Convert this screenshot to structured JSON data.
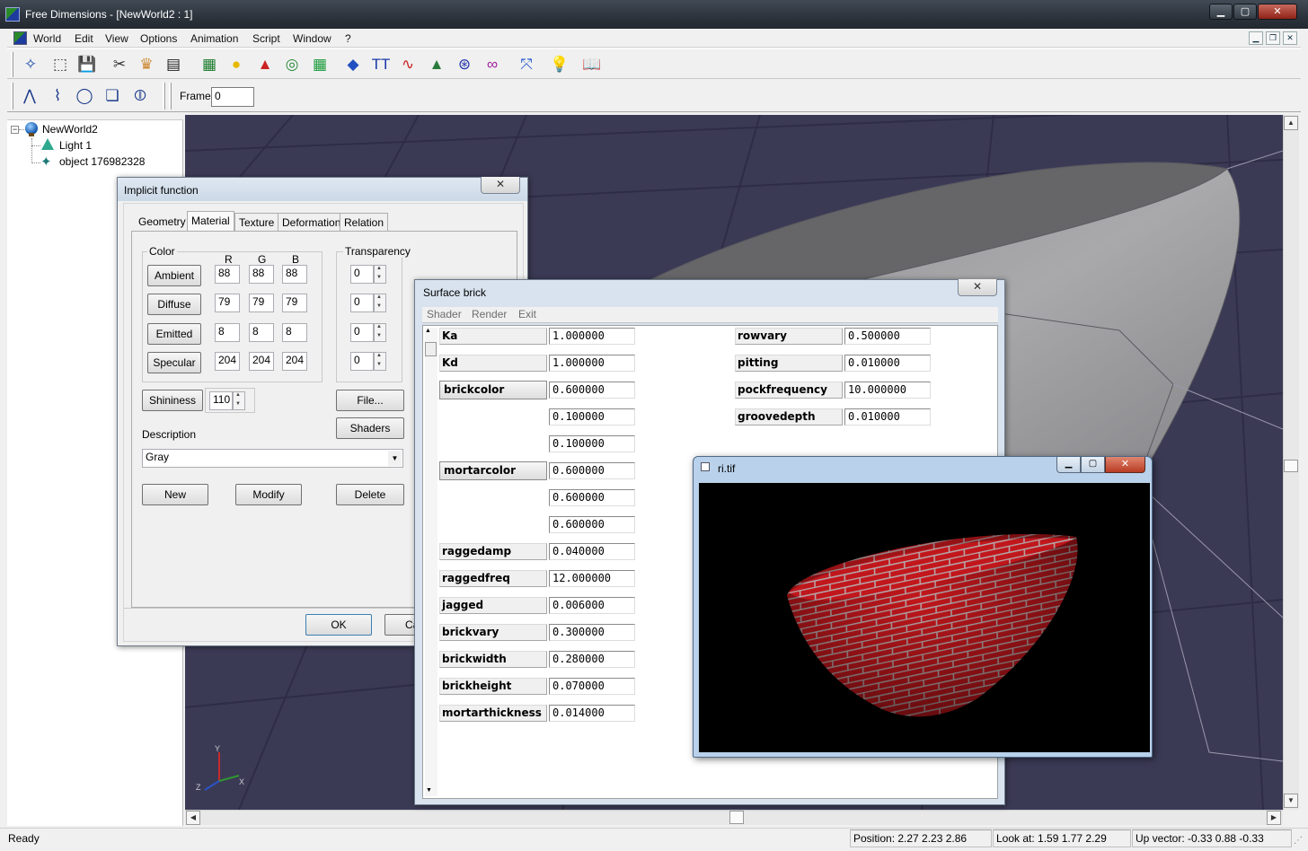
{
  "window": {
    "title": "Free Dimensions - [NewWorld2 : 1]"
  },
  "menu": [
    "World",
    "Edit",
    "View",
    "Options",
    "Animation",
    "Script",
    "Window",
    "?"
  ],
  "toolbar": {
    "icons": [
      "wand-icon",
      "box-icon",
      "save-icon",
      "cut-icon",
      "crown-icon",
      "clipboard-icon",
      "rubik-cube-icon",
      "sphere-icon",
      "cone-icon",
      "torus-icon",
      "grid-icon",
      "plane-icon",
      "text-icon",
      "curve-icon",
      "terrain-icon",
      "surface-icon",
      "infinity-icon",
      "axes-icon",
      "light-bulb-icon",
      "book-icon"
    ],
    "icon_glyphs": [
      "✧",
      "⬚",
      "💾",
      "✂",
      "♛",
      "▤",
      "▦",
      "●",
      "▲",
      "◎",
      "▦",
      "◆",
      "TT",
      "∿",
      "▲",
      "⊛",
      "∞",
      "⤧",
      "💡",
      "📖"
    ],
    "frame_label": "Frame:",
    "frame_value": "0",
    "edit_icons": [
      "polyline-icon",
      "spline-icon",
      "bezier-icon",
      "extrude-icon",
      "lathe-icon"
    ],
    "edit_glyphs": [
      "⋀",
      "⌇",
      "◯",
      "❏",
      "⦷"
    ]
  },
  "tree": {
    "root": "NewWorld2",
    "children": [
      "Light 1",
      "object 176982328"
    ]
  },
  "implicit_dialog": {
    "title": "Implicit function",
    "close": "✕",
    "tabs": [
      "Geometry",
      "Material",
      "Texture",
      "Deformation",
      "Relation"
    ],
    "color_group": "Color",
    "headers": [
      "R",
      "G",
      "B"
    ],
    "rows": [
      {
        "label": "Ambient",
        "r": "88",
        "g": "88",
        "b": "88",
        "t": "0"
      },
      {
        "label": "Diffuse",
        "r": "79",
        "g": "79",
        "b": "79",
        "t": "0"
      },
      {
        "label": "Emitted",
        "r": "8",
        "g": "8",
        "b": "8",
        "t": "0"
      },
      {
        "label": "Specular",
        "r": "204",
        "g": "204",
        "b": "204",
        "t": "0"
      }
    ],
    "transparency_group": "Transparency",
    "shininess_label": "Shininess",
    "shininess_value": "110",
    "file_button": "File...",
    "shaders_button": "Shaders",
    "description_label": "Description",
    "description_value": "Gray",
    "new_button": "New",
    "modify_button": "Modify",
    "delete_button": "Delete",
    "ok_button": "OK",
    "cancel_button": "Canc"
  },
  "surface_dialog": {
    "title": "Surface brick",
    "close": "✕",
    "menu": [
      "Shader",
      "Render",
      "Exit"
    ],
    "left_params": [
      {
        "label": "Ka",
        "values": [
          "1.000000"
        ]
      },
      {
        "label": "Kd",
        "values": [
          "1.000000"
        ]
      },
      {
        "label": "brickcolor",
        "button": true,
        "values": [
          "0.600000",
          "0.100000",
          "0.100000"
        ]
      },
      {
        "label": "mortarcolor",
        "button": true,
        "values": [
          "0.600000",
          "0.600000",
          "0.600000"
        ]
      },
      {
        "label": "raggedamp",
        "values": [
          "0.040000"
        ]
      },
      {
        "label": "raggedfreq",
        "values": [
          "12.000000"
        ]
      },
      {
        "label": "jagged",
        "values": [
          "0.006000"
        ]
      },
      {
        "label": "brickvary",
        "values": [
          "0.300000"
        ]
      },
      {
        "label": "brickwidth",
        "values": [
          "0.280000"
        ]
      },
      {
        "label": "brickheight",
        "values": [
          "0.070000"
        ]
      },
      {
        "label": "mortarthickness",
        "values": [
          "0.014000"
        ]
      }
    ],
    "right_params": [
      {
        "label": "rowvary",
        "value": "0.500000"
      },
      {
        "label": "pitting",
        "value": "0.010000"
      },
      {
        "label": "pockfrequency",
        "value": "10.000000"
      },
      {
        "label": "groovedepth",
        "value": "0.010000"
      }
    ]
  },
  "render_window": {
    "title": "ri.tif",
    "minimize": "▁",
    "maximize": "▢",
    "close": "✕"
  },
  "viewport": {
    "axis_labels": {
      "x": "X",
      "y": "Y",
      "z": "Z"
    }
  },
  "status": {
    "text": "Ready",
    "position": "Position: 2.27 2.23 2.86",
    "look_at": "Look at: 1.59 1.77 2.29",
    "up_vector": "Up vector: -0.33 0.88 -0.33"
  },
  "colors": {
    "viewport_bg": "#3b3a55",
    "grid": "#6d6a82",
    "accent": "#c8695d",
    "brick_red": "#c0141a"
  }
}
